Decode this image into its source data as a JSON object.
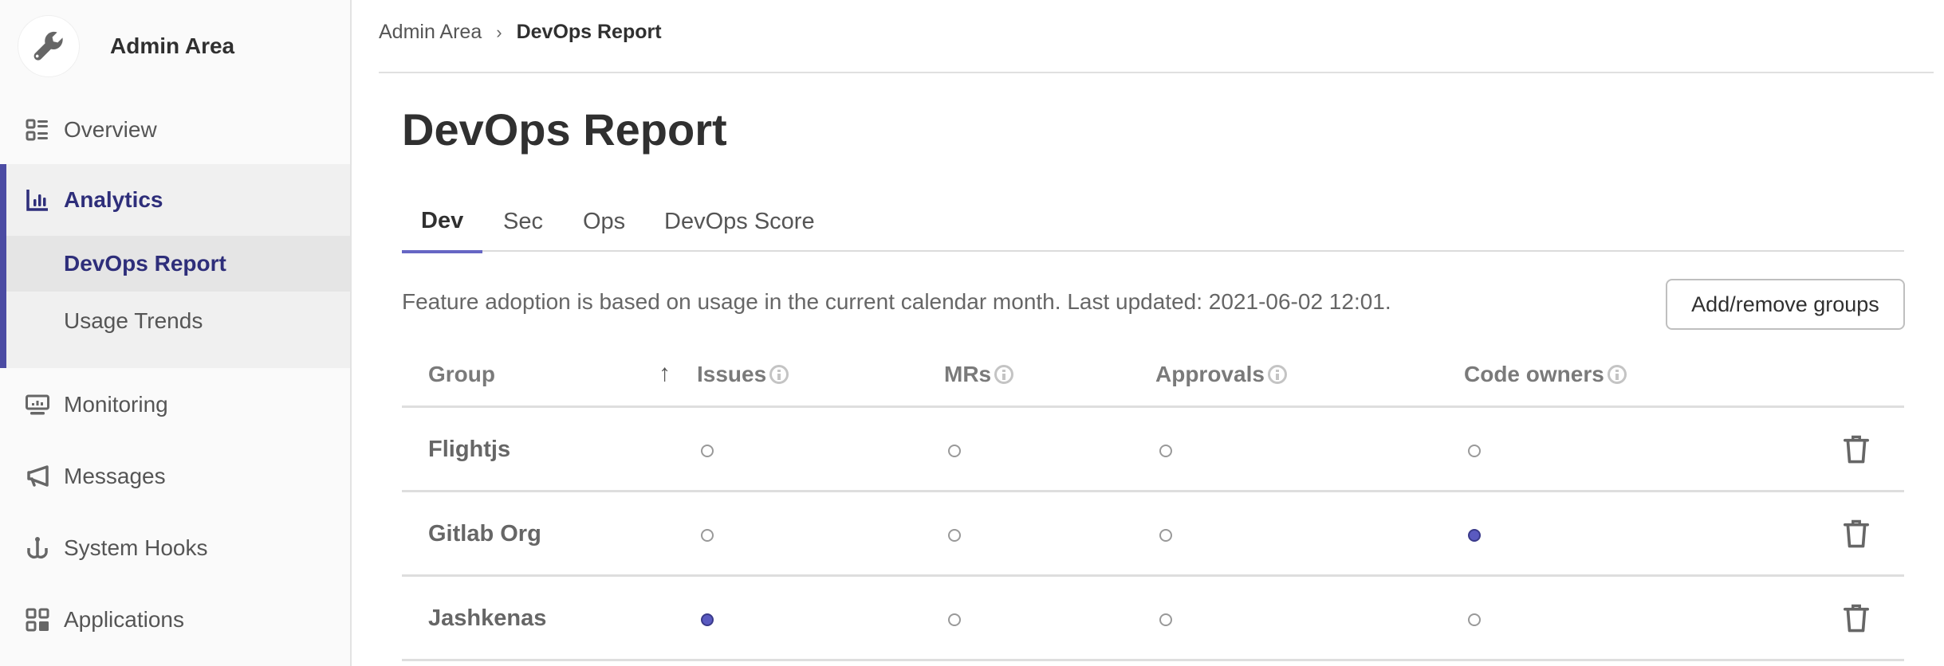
{
  "sidebar": {
    "brand": {
      "title": "Admin Area",
      "icon": "wrench-icon"
    },
    "items": [
      {
        "label": "Overview",
        "icon": "overview-icon"
      },
      {
        "label": "Analytics",
        "icon": "analytics-icon",
        "active": true,
        "children": [
          {
            "label": "DevOps Report",
            "active": true
          },
          {
            "label": "Usage Trends"
          }
        ]
      },
      {
        "label": "Monitoring",
        "icon": "monitor-icon"
      },
      {
        "label": "Messages",
        "icon": "megaphone-icon"
      },
      {
        "label": "System Hooks",
        "icon": "hook-icon"
      },
      {
        "label": "Applications",
        "icon": "applications-icon"
      }
    ]
  },
  "breadcrumb": {
    "parent": "Admin Area",
    "separator": "›",
    "current": "DevOps Report"
  },
  "page": {
    "title": "DevOps Report",
    "tabs": [
      {
        "label": "Dev",
        "active": true
      },
      {
        "label": "Sec"
      },
      {
        "label": "Ops"
      },
      {
        "label": "DevOps Score"
      }
    ],
    "description": "Feature adoption is based on usage in the current calendar month. Last updated: 2021-06-02 12:01.",
    "add_remove_button": "Add/remove groups"
  },
  "table": {
    "columns": [
      "Group",
      "Issues",
      "MRs",
      "Approvals",
      "Code owners"
    ],
    "sort": {
      "column": "Group",
      "direction": "ascending",
      "icon": "arrow-up-icon"
    },
    "rows": [
      {
        "group": "Flightjs",
        "issues": false,
        "mrs": false,
        "approvals": false,
        "code_owners": false
      },
      {
        "group": "Gitlab Org",
        "issues": false,
        "mrs": false,
        "approvals": false,
        "code_owners": true
      },
      {
        "group": "Jashkenas",
        "issues": true,
        "mrs": false,
        "approvals": false,
        "code_owners": false
      }
    ]
  },
  "colors": {
    "accent": "#4b4ba3",
    "adopted_dot": "#5a5ac0",
    "active_tab_underline": "#6666c4"
  }
}
